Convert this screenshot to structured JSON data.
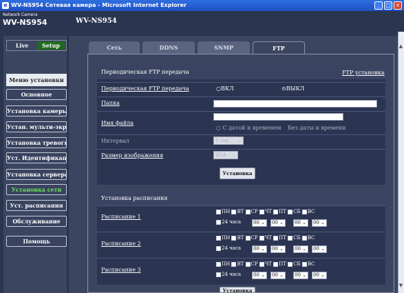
{
  "window": {
    "title": "WV-NS954 Сетевая камера - Microsoft Internet Explorer",
    "buttons": [
      "_",
      "□",
      "×"
    ]
  },
  "header": {
    "logo_top": "Network Camera",
    "logo_model": "WV-NS954",
    "model": "WV-NS954"
  },
  "sidebar": {
    "live": "Live",
    "setup": "Setup",
    "menu_title": "Меню установки",
    "items": [
      {
        "label": "Основное"
      },
      {
        "label": "Установка камеры"
      },
      {
        "label": "Устан. мульти-экрана"
      },
      {
        "label": "Установка тревоги"
      },
      {
        "label": "Уст. Идентификации"
      },
      {
        "label": "Установка сервера"
      },
      {
        "label": "Установка сети"
      },
      {
        "label": "Уст. расписания"
      },
      {
        "label": "Обслуживание"
      },
      {
        "label": "Помощь"
      }
    ]
  },
  "tabs": [
    {
      "label": "Сеть"
    },
    {
      "label": "DDNS"
    },
    {
      "label": "SNMP"
    },
    {
      "label": "FTP"
    }
  ],
  "ftp_section": {
    "title": "Периодическая FTP передача",
    "link": "FTP установка",
    "rows": {
      "periodic_label": "Периодическая FTP передача",
      "on": "ВКЛ",
      "off": "ВЫКЛ",
      "folder_label": "Папка",
      "folder_value": "",
      "filename_label": "Имя файла",
      "filename_value": "",
      "with_datetime": "С датой и временем",
      "without_datetime": "Без даты и времени",
      "interval_label": "Интервал",
      "interval_value": "1 сек.",
      "size_label": "Размер изображения",
      "size_value": "VGA"
    },
    "button": "Установка"
  },
  "schedule_section": {
    "title": "Установка расписания",
    "days": [
      "ПН",
      "ВТ",
      "СР",
      "ЧТ",
      "ПТ",
      "СБ",
      "ВС"
    ],
    "hours24": "24 часа",
    "time_value": "00",
    "rows": [
      {
        "label": "Расписание 1"
      },
      {
        "label": "Расписание 2"
      },
      {
        "label": "Расписание 3"
      }
    ],
    "button": "Установка"
  }
}
